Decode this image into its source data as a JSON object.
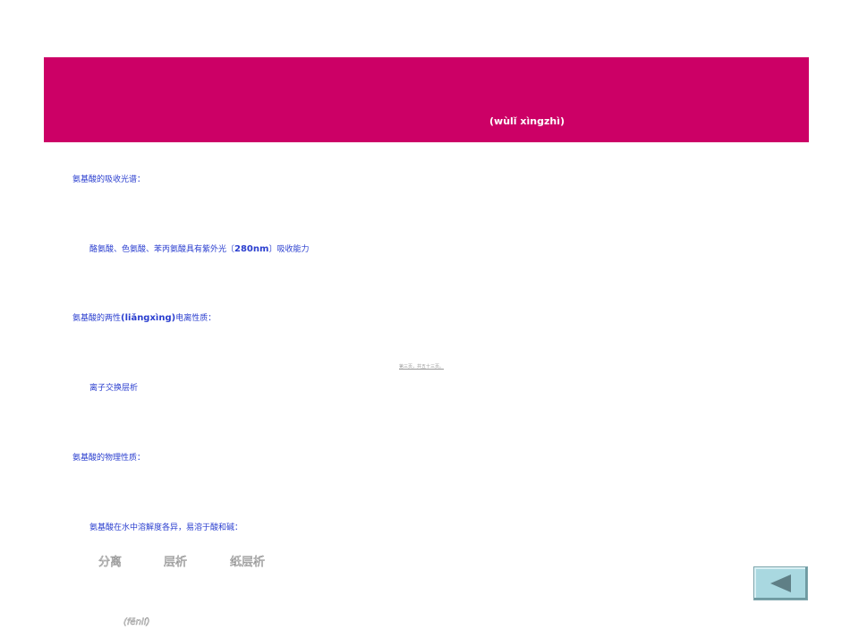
{
  "banner": {
    "subtitle": "(wùlǐ xìngzhì)",
    "color": "#cc0066"
  },
  "sections": [
    {
      "heading": "氨基酸的吸收光谱："
    },
    {
      "detail_pre": "酪氨酸、色氨酸、苯丙氨酸具有紫外光〔",
      "detail_bold": "280nm",
      "detail_post": "〕吸收能力"
    },
    {
      "heading_pre": "氨基酸的两性",
      "heading_bold": "(liǎngxìng)",
      "heading_post": "电离性质："
    },
    {
      "footer_note": "第三页，共五十三页。"
    },
    {
      "detail": "离子交换层析"
    },
    {
      "heading": "氨基酸的物理性质："
    },
    {
      "detail": "氨基酸在水中溶解度各异，易溶于酸和碱："
    }
  ],
  "outlined_terms": [
    "分离",
    "层析",
    "纸层析"
  ],
  "outlined_pinyin": "(fēnlí)",
  "nav": {
    "back_icon": "left-triangle-icon",
    "button_color": "#a9d8e0",
    "arrow_color": "#5f7f86"
  },
  "text_color": "#2b3fcf"
}
